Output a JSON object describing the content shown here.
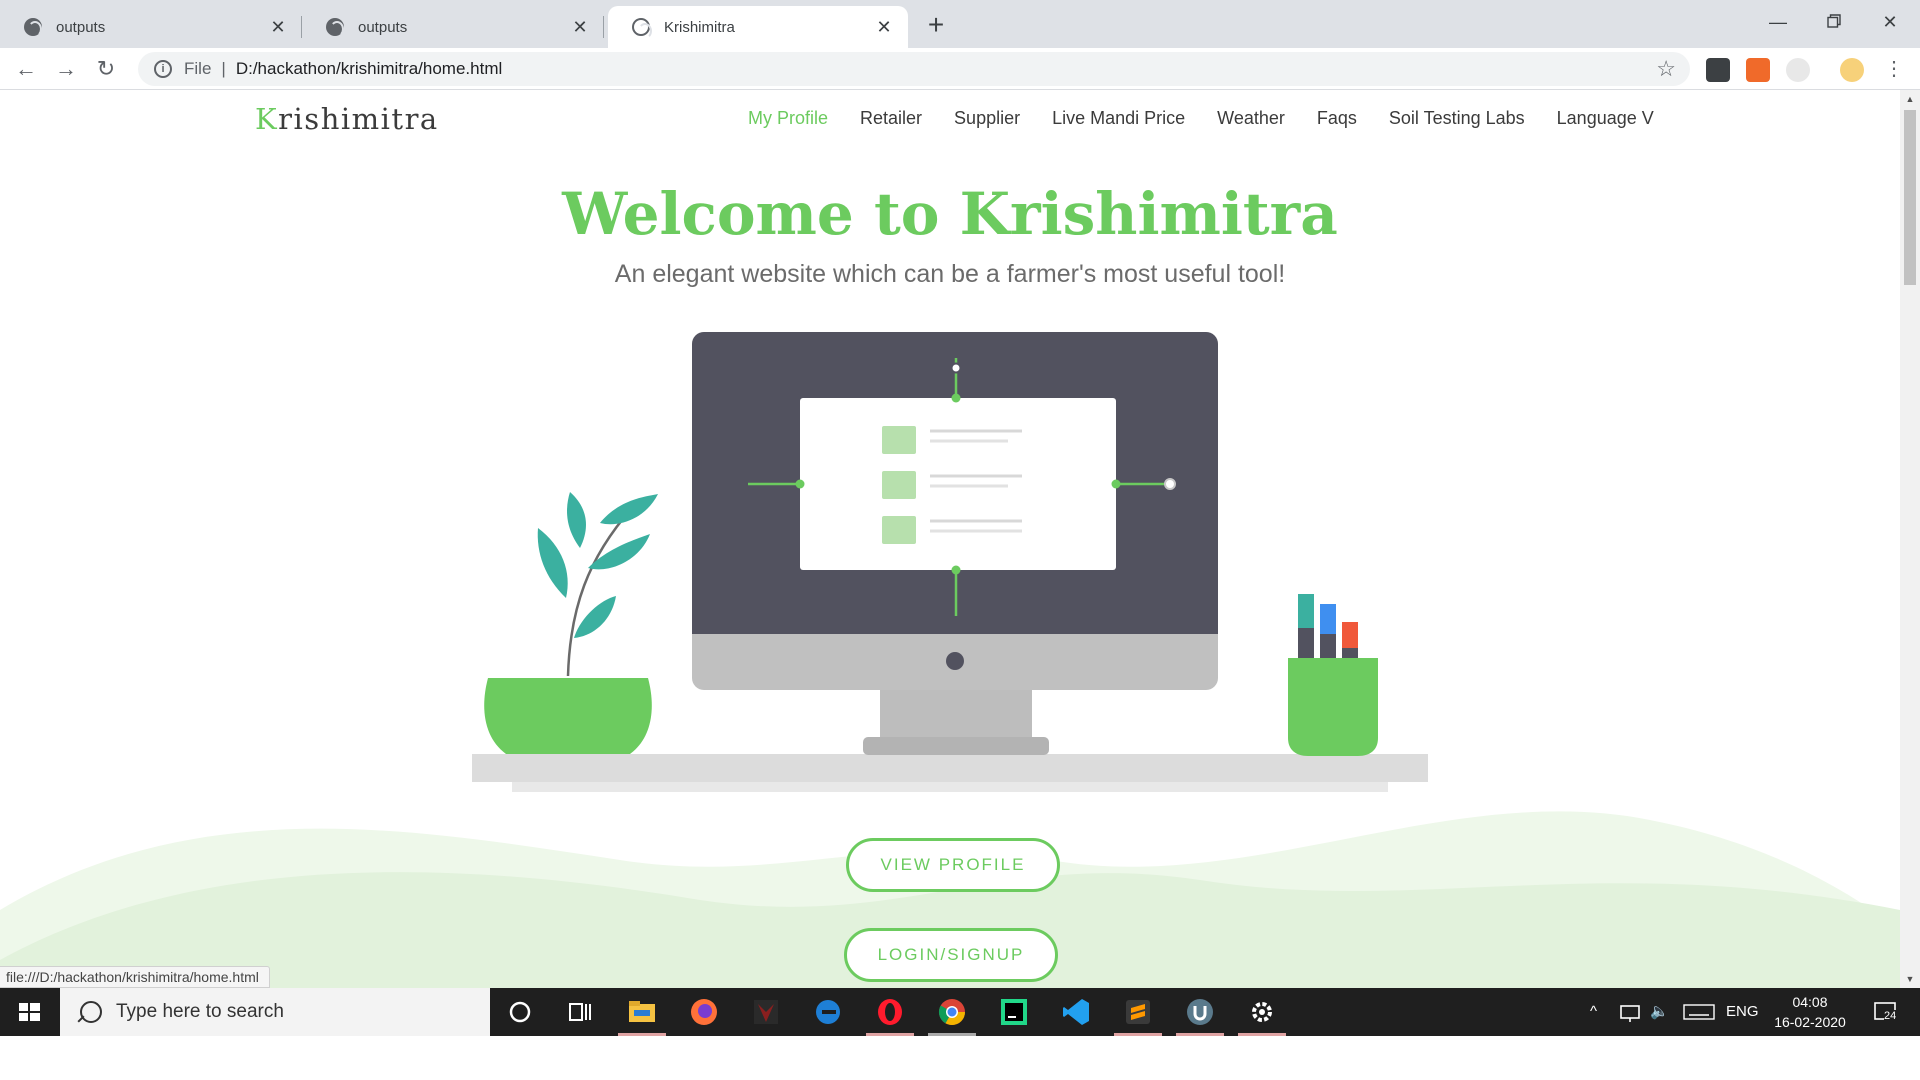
{
  "browser": {
    "tabs": [
      {
        "title": "outputs",
        "active": false
      },
      {
        "title": "outputs",
        "active": false
      },
      {
        "title": "Krishimitra",
        "active": true
      }
    ],
    "new_tab_label": "+",
    "address": {
      "scheme": "File",
      "path": "D:/hackathon/krishimitra/home.html"
    },
    "status_url": "file:///D:/hackathon/krishimitra/home.html"
  },
  "site": {
    "brand": {
      "first": "K",
      "rest": "rishimitra"
    },
    "nav": [
      "My Profile",
      "Retailer",
      "Supplier",
      "Live Mandi Price",
      "Weather",
      "Faqs",
      "Soil Testing Labs",
      "Language V"
    ],
    "active_nav": "My Profile",
    "hero_title": "Welcome to Krishimitra",
    "hero_subtitle": "An elegant website which can be a farmer's most useful tool!",
    "buttons": {
      "view_profile": "VIEW PROFILE",
      "login_signup": "LOGIN/SIGNUP"
    },
    "colors": {
      "accent": "#6ccb5f",
      "text": "#3b3b3b",
      "monitor": "#52525f",
      "hills": "#e4f3df"
    }
  },
  "taskbar": {
    "search_placeholder": "Type here to search",
    "apps": [
      "cortana-icon",
      "task-view-icon",
      "file-explorer-icon",
      "firefox-icon",
      "predator-icon",
      "edge-icon",
      "opera-icon",
      "chrome-icon",
      "pycharm-icon",
      "vscode-icon",
      "sublime-icon",
      "ubuntu-icon",
      "settings-icon"
    ],
    "language": "ENG",
    "time": "04:08",
    "date": "16-02-2020",
    "notification_count": "24"
  }
}
